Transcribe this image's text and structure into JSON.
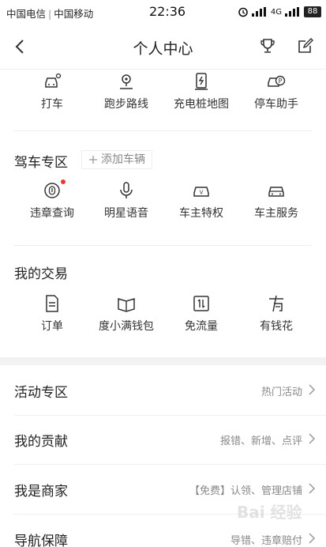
{
  "status_bar": {
    "carrier1": "中国电信",
    "carrier2": "中国移动",
    "time": "22:36",
    "network": "4G",
    "battery": "88"
  },
  "nav": {
    "title": "个人中心"
  },
  "top_tools": [
    {
      "label": "打车",
      "icon": "taxi-icon"
    },
    {
      "label": "跑步路线",
      "icon": "run-route-icon"
    },
    {
      "label": "充电桩地图",
      "icon": "charging-pile-icon"
    },
    {
      "label": "停车助手",
      "icon": "parking-icon"
    }
  ],
  "driving": {
    "title": "驾车专区",
    "add_vehicle": "添加车辆",
    "items": [
      {
        "label": "违章查询",
        "icon": "violation-query-icon"
      },
      {
        "label": "明星语音",
        "icon": "microphone-icon"
      },
      {
        "label": "车主特权",
        "icon": "car-privilege-icon"
      },
      {
        "label": "车主服务",
        "icon": "car-service-icon"
      }
    ]
  },
  "trade": {
    "title": "我的交易",
    "items": [
      {
        "label": "订单",
        "icon": "order-icon"
      },
      {
        "label": "度小满钱包",
        "icon": "wallet-icon"
      },
      {
        "label": "免流量",
        "icon": "free-data-icon"
      },
      {
        "label": "有钱花",
        "icon": "loan-icon"
      }
    ]
  },
  "list": [
    {
      "title": "活动专区",
      "desc": "热门活动"
    },
    {
      "title": "我的贡献",
      "desc": "报错、新增、点评"
    },
    {
      "title": "我是商家",
      "desc": "【免费】认领、管理店铺"
    },
    {
      "title": "导航保障",
      "desc": "导错、违章赔付"
    }
  ],
  "watermark": "Bai 经验",
  "colors": {
    "accent_dot": "#e53935",
    "divider": "#eeeeee",
    "secondary_text": "#888888"
  }
}
